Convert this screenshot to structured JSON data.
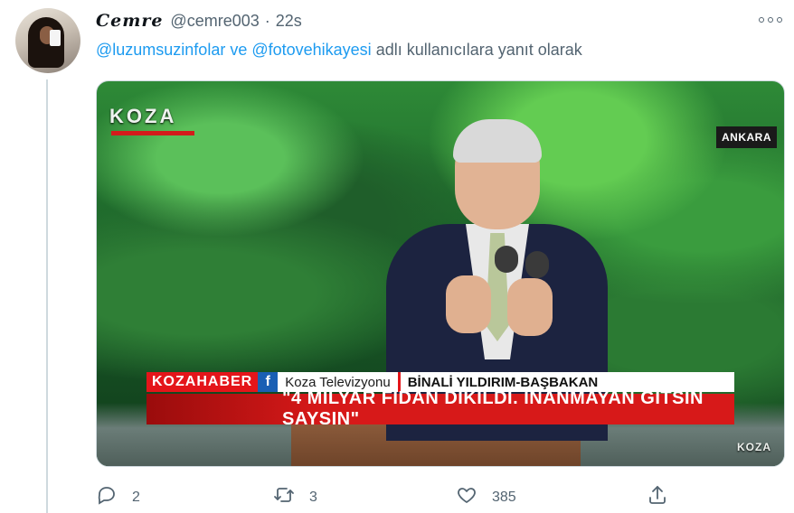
{
  "tweet": {
    "display_name": "Cemre",
    "handle": "@cemre003",
    "separator": "·",
    "time": "22s",
    "reply_to": {
      "mention_1": "@luzumsuzinfolar",
      "conjunction": " ve ",
      "mention_2": "@fotovehikayesi",
      "suffix": " adlı kullanıcılara yanıt olarak"
    },
    "media": {
      "logo": "KOZA",
      "location": "ANKARA",
      "lower_third": {
        "brand": "KOZAHABER",
        "facebook_glyph": "f",
        "channel": "Koza Televizyonu",
        "name": "BİNALİ YILDIRIM-BAŞBAKAN",
        "quote": "\"4 MİLYAR FİDAN DİKİLDİ. İNANMAYAN GİTSİN SAYSIN\""
      },
      "corner_logo": "KOZA"
    },
    "actions": {
      "reply_count": "2",
      "retweet_count": "3",
      "like_count": "385"
    }
  },
  "icons": [
    "more-icon",
    "reply-icon",
    "retweet-icon",
    "like-icon",
    "share-icon"
  ],
  "colors": {
    "accent": "#1d9bf0",
    "muted": "#536471",
    "text": "#0f1419"
  }
}
